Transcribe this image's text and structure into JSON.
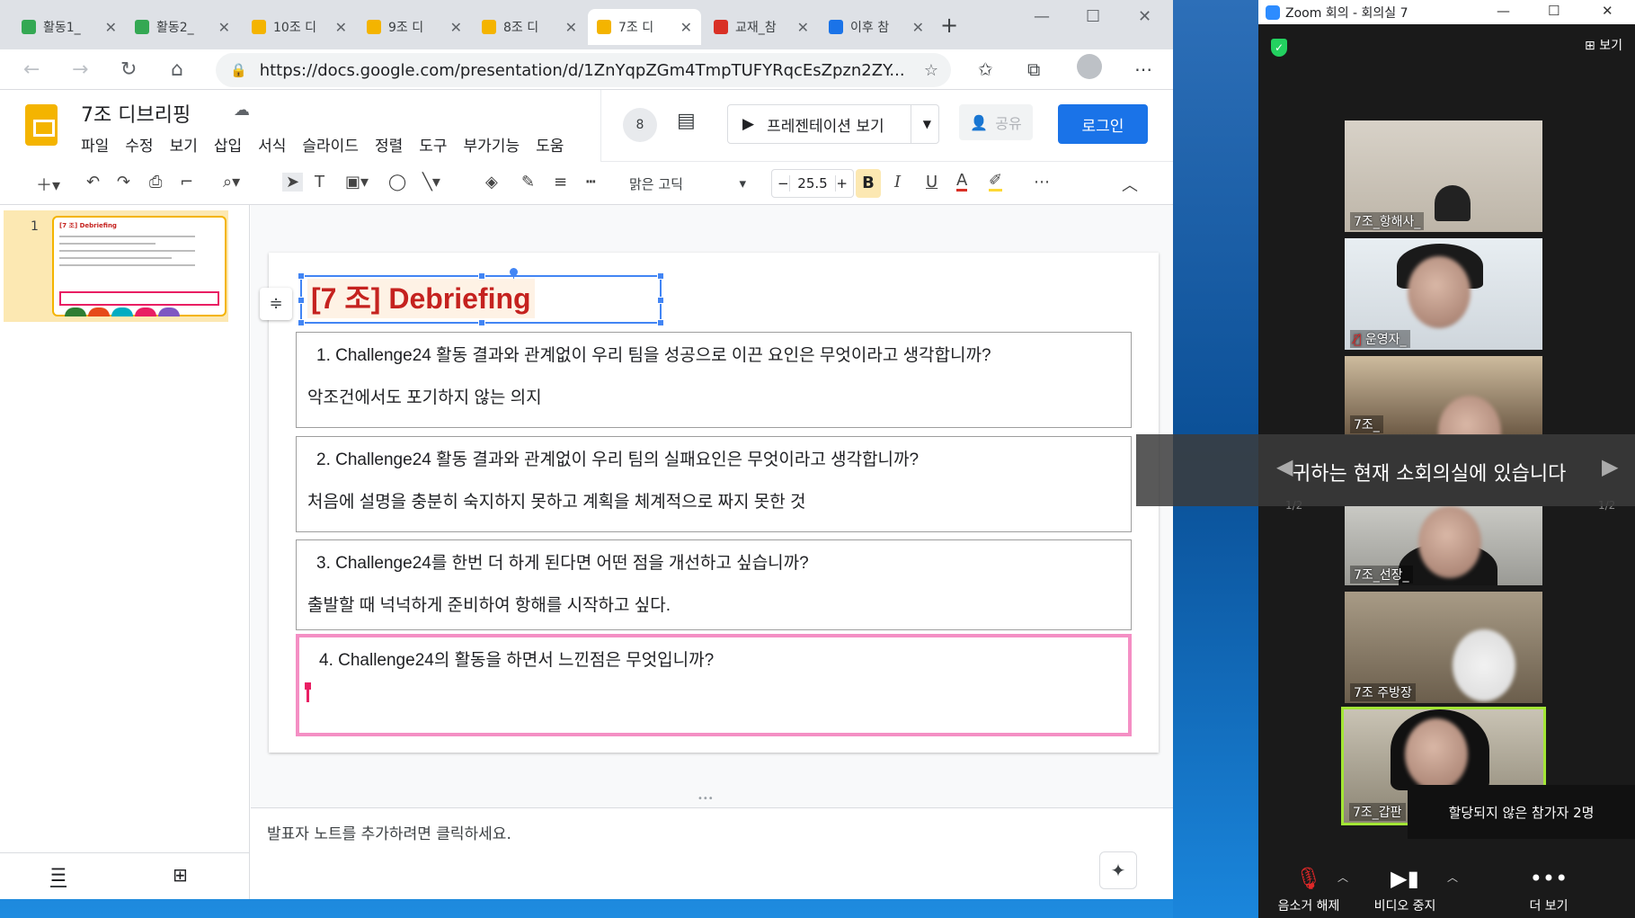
{
  "browser": {
    "tabs": [
      {
        "label": "활동1_",
        "color": "#34a853"
      },
      {
        "label": "활동2_",
        "color": "#34a853"
      },
      {
        "label": "10조 디",
        "color": "#f4b400"
      },
      {
        "label": "9조 디",
        "color": "#f4b400"
      },
      {
        "label": "8조 디",
        "color": "#f4b400"
      },
      {
        "label": "7조 디",
        "color": "#f4b400"
      },
      {
        "label": "교재_참",
        "color": "#d93025"
      },
      {
        "label": "이후 참",
        "color": "#1a73e8"
      }
    ],
    "url": "https://docs.google.com/presentation/d/1ZnYqpZGm4TmpTUFYRqcEsZpzn2ZY..."
  },
  "slides_app": {
    "doc_title": "7조 디브리핑",
    "menu": [
      "파일",
      "수정",
      "보기",
      "삽입",
      "서식",
      "슬라이드",
      "정렬",
      "도구",
      "부가기능",
      "도움"
    ],
    "comment_count": "8",
    "present_label": "프레젠테이션 보기",
    "share_label": "공유",
    "login_label": "로그인",
    "font_name": "맑은 고딕",
    "font_size": "25.5",
    "bold_label": "B",
    "slide_number": "1",
    "thumb_title": "[7 조] Debriefing",
    "slide": {
      "title": "[7 조] Debriefing",
      "questions": [
        {
          "q": "1.  Challenge24 활동 결과와 관계없이 우리 팀을 성공으로 이끈 요인은 무엇이라고 생각합니까?",
          "a": "악조건에서도 포기하지 않는 의지"
        },
        {
          "q": "2.  Challenge24 활동 결과와 관계없이 우리 팀의 실패요인은 무엇이라고 생각합니까?",
          "a": "처음에 설명을 충분히 숙지하지 못하고 계획을 체계적으로 짜지 못한 것"
        },
        {
          "q": "3.  Challenge24를 한번 더 하게 된다면 어떤 점을 개선하고 싶습니까?",
          "a": "출발할 때 넉넉하게 준비하여 항해를 시작하고 싶다."
        },
        {
          "q": "4.  Challenge24의 활동을 하면서 느낀점은 무엇입니까?",
          "a": ""
        }
      ]
    },
    "notes_placeholder": "발표자 노트를 추가하려면 클릭하세요."
  },
  "zoom": {
    "window_title": "Zoom 회의 - 회의실 7",
    "view_label": "보기",
    "participants": [
      {
        "name": "7조_항해사_",
        "muted": false
      },
      {
        "name": "운영자_",
        "muted": true
      },
      {
        "name": "7조_",
        "muted": false
      },
      {
        "name": "7조_선장_",
        "muted": false
      },
      {
        "name": "7조 주방장",
        "muted": false
      },
      {
        "name": "7조_갑판",
        "muted": false
      }
    ],
    "overlay_message": "귀하는 현재 소회의실에 있습니다",
    "page_indicator": "1/2",
    "tooltip": "할당되지 않은 참가자 2명",
    "controls": {
      "unmute": "음소거 해제",
      "video": "비디오 중지",
      "more": "더 보기"
    }
  }
}
